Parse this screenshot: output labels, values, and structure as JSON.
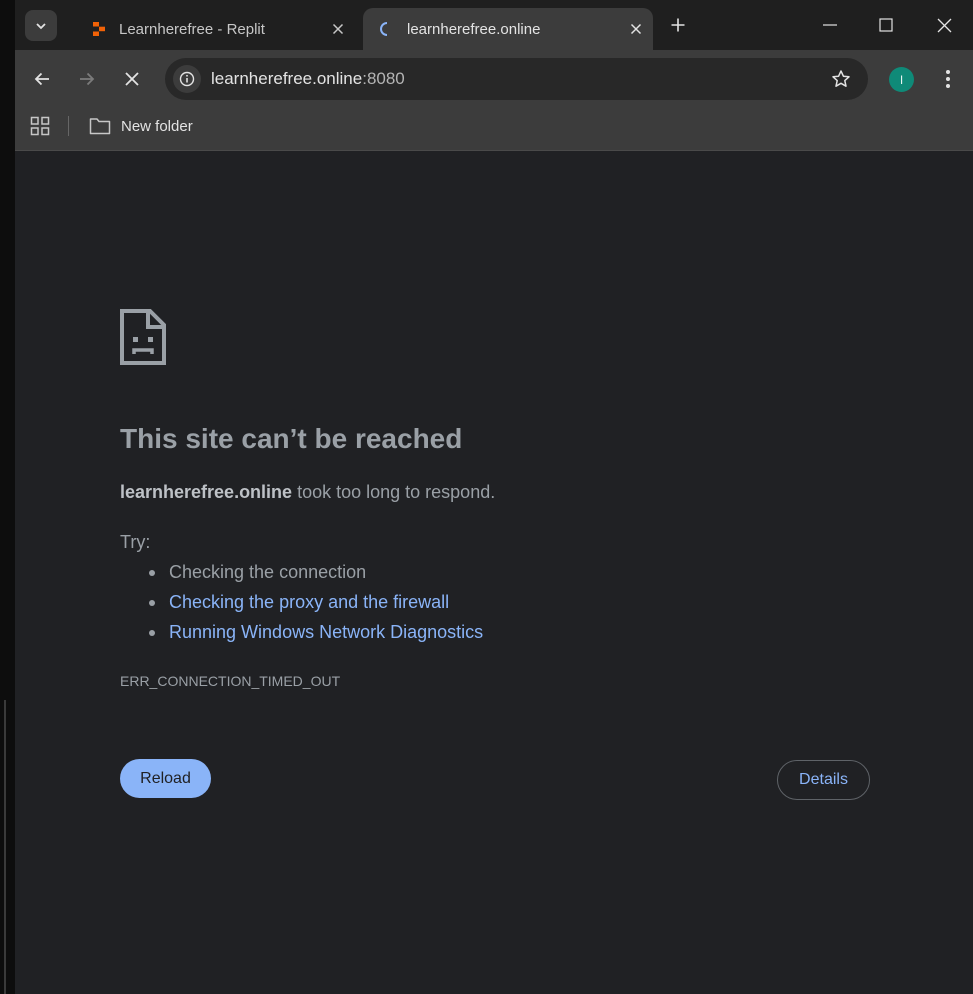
{
  "tabs": [
    {
      "title": "Learnherefree - Replit",
      "active": false,
      "favicon": "replit-icon"
    },
    {
      "title": "learnherefree.online",
      "active": true,
      "favicon": "loading-spinner-icon"
    }
  ],
  "address_bar": {
    "host": "learnherefree.online",
    "port": ":8080"
  },
  "profile": {
    "initial": "I",
    "color": "#0f8a78"
  },
  "bookmarks": [
    {
      "label": "New folder",
      "icon": "folder-icon"
    }
  ],
  "error_page": {
    "headline": "This site can’t be reached",
    "host": "learnherefree.online",
    "message": " took too long to respond.",
    "try_label": "Try:",
    "suggestions": [
      {
        "text": "Checking the connection",
        "link": false
      },
      {
        "text": "Checking the proxy and the firewall",
        "link": true
      },
      {
        "text": "Running Windows Network Diagnostics",
        "link": true
      }
    ],
    "error_code": "ERR_CONNECTION_TIMED_OUT",
    "reload_label": "Reload",
    "details_label": "Details"
  },
  "colors": {
    "link": "#8ab4f8",
    "background": "#202124",
    "text": "#9aa0a6",
    "replit_accent": "#f26207"
  }
}
